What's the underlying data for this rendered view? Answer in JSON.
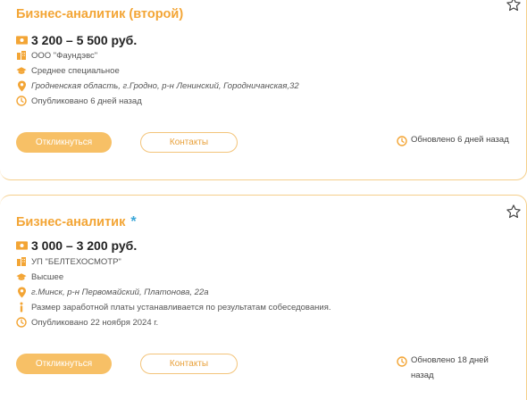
{
  "vacancies": [
    {
      "title": "Бизнес-аналитик (второй)",
      "salary": "3 200 – 5 500 руб.",
      "company": "ООО \"Фаундэвс\"",
      "education": "Среднее специальное",
      "address": "Гродненская область, г.Гродно, р-н Ленинский, Городничанская,32",
      "published": "Опубликовано 6 дней назад",
      "respond_label": "Откликнуться",
      "contacts_label": "Контакты",
      "updated": "Обновлено 6 дней назад"
    },
    {
      "title": "Бизнес-аналитик",
      "badge": "*",
      "salary": "3 000 – 3 200 руб.",
      "company": "УП \"БЕЛТЕХОСМОТР\"",
      "education": "Высшее",
      "address": "г.Минск, р-н Первомайский, Платонова, 22а",
      "salary_note": "Размер заработной платы устанавливается по результатам собеседования.",
      "published": "Опубликовано 22 ноября 2024 г.",
      "respond_label": "Откликнуться",
      "contacts_label": "Контакты",
      "updated": "Обновлено 18 дней назад"
    }
  ],
  "colors": {
    "accent": "#f3a535",
    "button": "#f7c066",
    "border": "#f5cf8a"
  }
}
